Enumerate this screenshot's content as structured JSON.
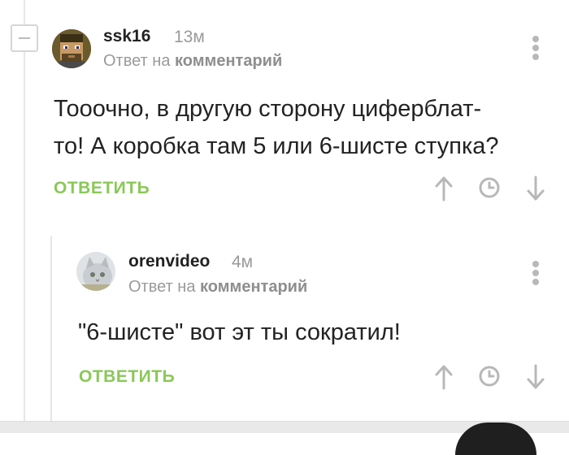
{
  "comment": {
    "username": "ssk16",
    "time": "13м",
    "reply_to_prefix": "Ответ на",
    "reply_to_link": "комментарий",
    "text_line1": "Тооочно, в другую сторону циферблат-",
    "text_line2": "то! А коробка там 5 или 6-шисте ступка?",
    "reply_label": "ОТВЕТИТЬ"
  },
  "reply": {
    "username": "orenvideo",
    "time": "4м",
    "reply_to_prefix": "Ответ на",
    "reply_to_link": "комментарий",
    "text": "\"6-шисте\" вот эт ты сократил!",
    "reply_label": "ОТВЕТИТЬ"
  },
  "colors": {
    "accent_green": "#8ac858",
    "muted_text": "#9a9a9a",
    "icon_gray": "#b8b8b8"
  },
  "icons": [
    "collapse-icon",
    "more-vertical-icon",
    "arrow-up-icon",
    "clock-icon",
    "arrow-down-icon"
  ]
}
